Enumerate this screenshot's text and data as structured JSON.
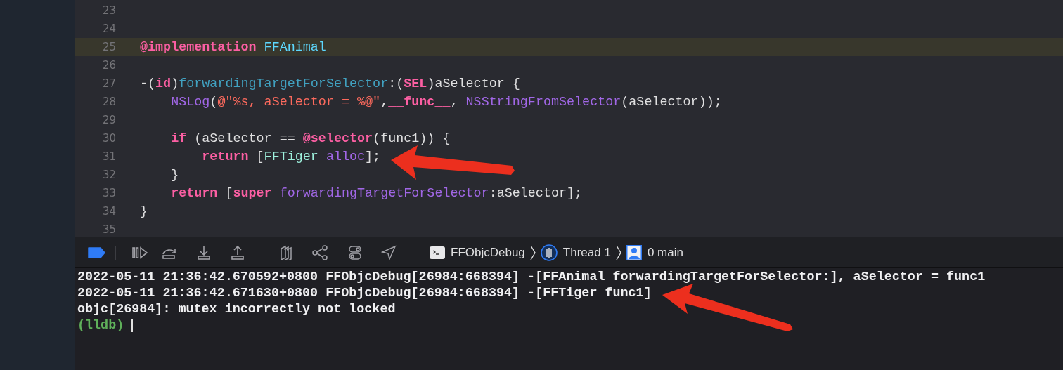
{
  "editor": {
    "lines": [
      {
        "number": "23",
        "highlighted": false
      },
      {
        "number": "24",
        "highlighted": false
      },
      {
        "number": "25",
        "highlighted": true,
        "tokens": [
          {
            "kind": "keyword",
            "text": "@implementation "
          },
          {
            "kind": "class-decl",
            "text": "FFAnimal"
          }
        ]
      },
      {
        "number": "26",
        "highlighted": false
      },
      {
        "number": "27",
        "highlighted": false,
        "tokens": [
          {
            "kind": "plain",
            "text": "-("
          },
          {
            "kind": "keyword",
            "text": "id"
          },
          {
            "kind": "plain",
            "text": ")"
          },
          {
            "kind": "method-decl",
            "text": "forwardingTargetForSelector"
          },
          {
            "kind": "plain",
            "text": ":("
          },
          {
            "kind": "keyword",
            "text": "SEL"
          },
          {
            "kind": "plain",
            "text": ")aSelector {"
          }
        ]
      },
      {
        "number": "28",
        "highlighted": false,
        "tokens": [
          {
            "kind": "function",
            "text": "    NSLog"
          },
          {
            "kind": "plain",
            "text": "("
          },
          {
            "kind": "string",
            "text": "@\"%s, aSelector = %@\""
          },
          {
            "kind": "plain",
            "text": ","
          },
          {
            "kind": "keyword",
            "text": "__func__"
          },
          {
            "kind": "plain",
            "text": ", "
          },
          {
            "kind": "function",
            "text": "NSStringFromSelector"
          },
          {
            "kind": "plain",
            "text": "(aSelector));"
          }
        ]
      },
      {
        "number": "29",
        "highlighted": false
      },
      {
        "number": "30",
        "highlighted": false,
        "tokens": [
          {
            "kind": "keyword",
            "text": "    if"
          },
          {
            "kind": "plain",
            "text": " (aSelector == "
          },
          {
            "kind": "keyword",
            "text": "@selector"
          },
          {
            "kind": "plain",
            "text": "(func1)) {"
          }
        ]
      },
      {
        "number": "31",
        "highlighted": false,
        "tokens": [
          {
            "kind": "keyword",
            "text": "        return"
          },
          {
            "kind": "plain",
            "text": " ["
          },
          {
            "kind": "class-ref",
            "text": "FFTiger "
          },
          {
            "kind": "function",
            "text": "alloc"
          },
          {
            "kind": "plain",
            "text": "];"
          }
        ]
      },
      {
        "number": "32",
        "highlighted": false,
        "tokens": [
          {
            "kind": "plain",
            "text": "    }"
          }
        ]
      },
      {
        "number": "33",
        "highlighted": false,
        "tokens": [
          {
            "kind": "keyword",
            "text": "    return"
          },
          {
            "kind": "plain",
            "text": " ["
          },
          {
            "kind": "keyword",
            "text": "super "
          },
          {
            "kind": "function",
            "text": "forwardingTargetForSelector"
          },
          {
            "kind": "plain",
            "text": ":aSelector];"
          }
        ]
      },
      {
        "number": "34",
        "highlighted": false,
        "tokens": [
          {
            "kind": "plain",
            "text": "}"
          }
        ]
      },
      {
        "number": "35",
        "highlighted": false
      }
    ]
  },
  "debug_bar": {
    "breakpoints_active": true,
    "breadcrumbs": [
      {
        "kind": "process",
        "label": "FFObjcDebug"
      },
      {
        "kind": "thread",
        "label": "Thread 1"
      },
      {
        "kind": "frame",
        "label": "0 main"
      }
    ]
  },
  "console": {
    "lines": [
      {
        "text": "2022-05-11 21:36:42.670592+0800 FFObjcDebug[26984:668394] -[FFAnimal forwardingTargetForSelector:], aSelector = func1"
      },
      {
        "text": "2022-05-11 21:36:42.671630+0800 FFObjcDebug[26984:668394] -[FFTiger func1]"
      },
      {
        "text": "objc[26984]: mutex incorrectly not locked"
      }
    ],
    "prompt": "(lldb)"
  }
}
